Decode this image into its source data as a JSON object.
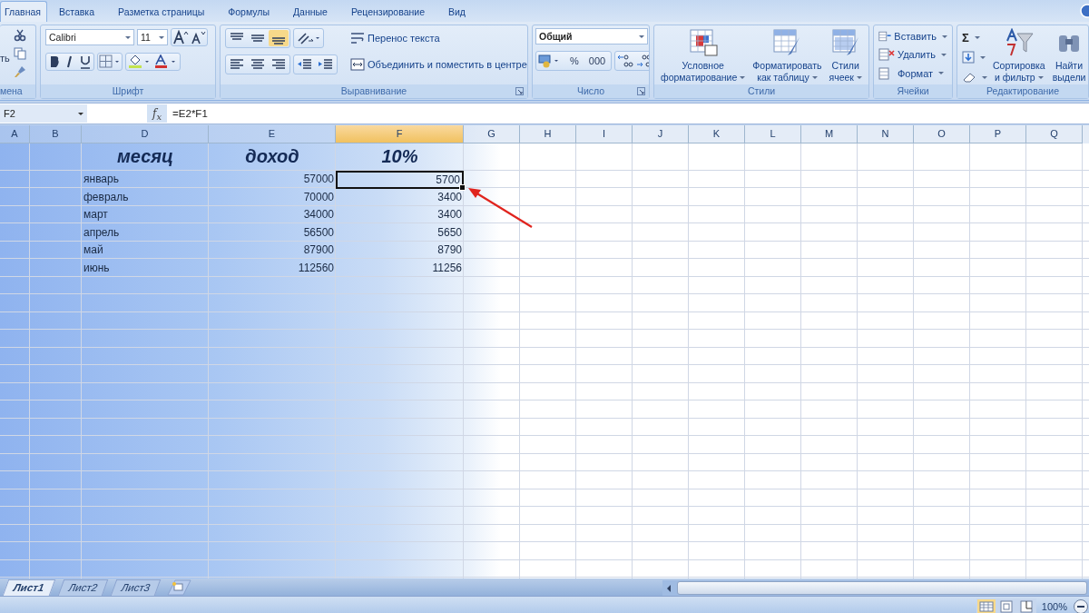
{
  "tabs": [
    {
      "label": "Главная",
      "selected": true
    },
    {
      "label": "Вставка",
      "selected": false
    },
    {
      "label": "Разметка страницы",
      "selected": false
    },
    {
      "label": "Формулы",
      "selected": false
    },
    {
      "label": "Данные",
      "selected": false
    },
    {
      "label": "Рецензирование",
      "selected": false
    },
    {
      "label": "Вид",
      "selected": false
    }
  ],
  "ribbon": {
    "clipboard": {
      "label": "мена",
      "paste": "ть"
    },
    "font": {
      "label": "Шрифт",
      "font": "Calibri",
      "size": "11"
    },
    "alignment": {
      "label": "Выравнивание",
      "valign": [
        {
          "selected": false
        },
        {
          "selected": false
        },
        {
          "selected": true
        }
      ],
      "wrap": "Перенос текста",
      "merge": "Объединить и поместить в центре"
    },
    "number": {
      "label": "Число",
      "format": "Общий",
      "percent": "%",
      "thousands": "000"
    },
    "styles": {
      "label": "Стили",
      "buttons": [
        {
          "lines": [
            "Условное",
            "форматирование"
          ]
        },
        {
          "lines": [
            "Форматировать",
            "как таблицу"
          ]
        },
        {
          "lines": [
            "Стили",
            "ячеек"
          ]
        }
      ]
    },
    "cells": {
      "label": "Ячейки",
      "buttons": [
        "Вставить",
        "Удалить",
        "Формат"
      ]
    },
    "editing": {
      "label": "Редактирование",
      "sum": "Σ",
      "buttons": [
        {
          "lines": [
            "Сортировка",
            "и фильтр"
          ],
          "dropdown": true
        },
        {
          "lines": [
            "Найти",
            "выдели"
          ],
          "dropdown": false
        }
      ]
    }
  },
  "formula_bar": {
    "name_box": "F2",
    "fx": "f$_{x}$",
    "formula": "=E2*F1"
  },
  "columns": [
    {
      "label": "A",
      "selected": false
    },
    {
      "label": "B",
      "selected": false
    },
    {
      "label": "D",
      "selected": false
    },
    {
      "label": "E",
      "selected": false
    },
    {
      "label": "F",
      "selected": true
    },
    {
      "label": "G",
      "selected": false
    },
    {
      "label": "H",
      "selected": false
    },
    {
      "label": "I",
      "selected": false
    },
    {
      "label": "J",
      "selected": false
    },
    {
      "label": "K",
      "selected": false
    },
    {
      "label": "L",
      "selected": false
    },
    {
      "label": "M",
      "selected": false
    },
    {
      "label": "N",
      "selected": false
    },
    {
      "label": "O",
      "selected": false
    },
    {
      "label": "P",
      "selected": false
    },
    {
      "label": "Q",
      "selected": false
    }
  ],
  "table": {
    "header": [
      "месяц",
      "доход",
      "10%"
    ],
    "rows": [
      {
        "month": "январь",
        "income": "57000",
        "share": "5700",
        "selected": true
      },
      {
        "month": "февраль",
        "income": "70000",
        "share": "3400",
        "selected": false
      },
      {
        "month": "март",
        "income": "34000",
        "share": "3400",
        "selected": false
      },
      {
        "month": "апрель",
        "income": "56500",
        "share": "5650",
        "selected": false
      },
      {
        "month": "май",
        "income": "87900",
        "share": "8790",
        "selected": false
      },
      {
        "month": "июнь",
        "income": "112560",
        "share": "11256",
        "selected": false
      }
    ]
  },
  "sheet_tabs": [
    {
      "label": "Лист1",
      "selected": true
    },
    {
      "label": "Лист2",
      "selected": false
    },
    {
      "label": "Лист3",
      "selected": false
    }
  ],
  "status_bar": {
    "zoom": "100%"
  }
}
